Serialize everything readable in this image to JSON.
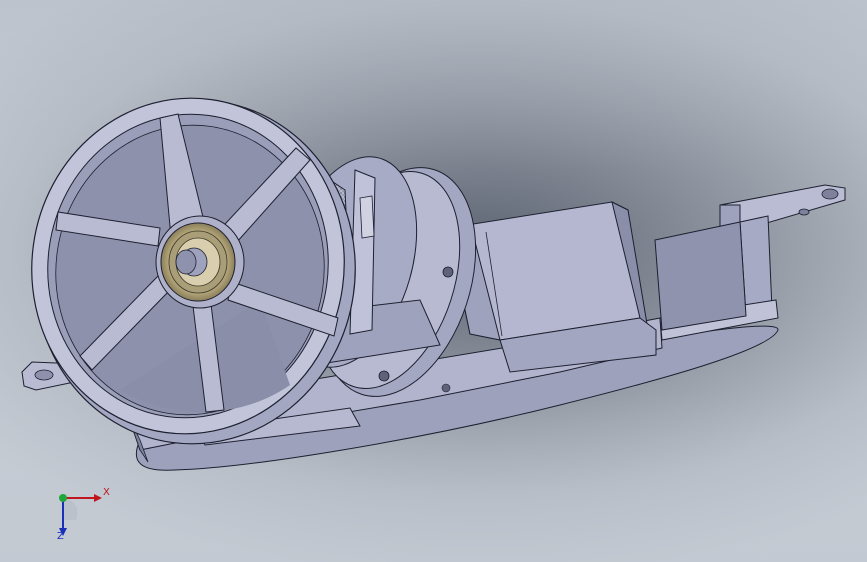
{
  "viewport": {
    "name": "3d-model-view"
  },
  "triad": {
    "x_label": "X",
    "z_label": "Z",
    "colors": {
      "x": "#c0161e",
      "y": "#1fa83a",
      "z": "#1a2fb8"
    }
  },
  "model": {
    "base_color": "#a7abc6",
    "shadow_color": "#7c809b",
    "highlight_color": "#c4c7dc",
    "bearing_color": "#c8b98a"
  }
}
